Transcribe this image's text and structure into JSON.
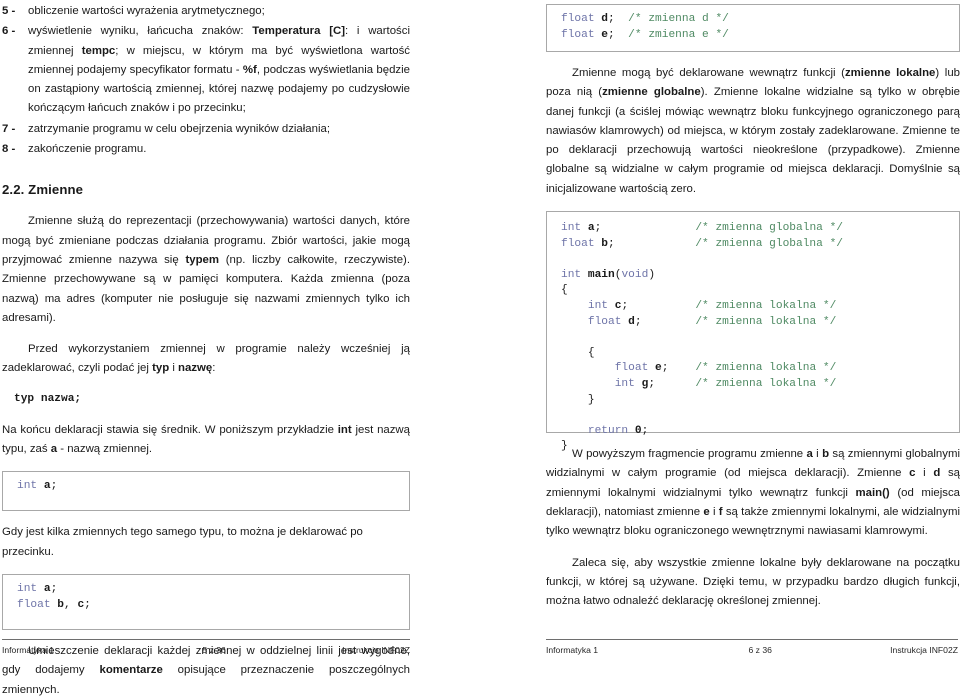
{
  "left_page": {
    "list": [
      {
        "num": "5 -",
        "parts": [
          {
            "t": "obliczenie wartości wyrażenia arytmetycznego;",
            "b": false
          }
        ]
      },
      {
        "num": "6 -",
        "parts": [
          {
            "t": "wyświetlenie wyniku, łańcucha znaków: ",
            "b": false
          },
          {
            "t": "Temperatura [C]",
            "b": true
          },
          {
            "t": ": i wartości zmiennej ",
            "b": false
          },
          {
            "t": "tempc",
            "b": true
          },
          {
            "t": "; w miejscu, w którym ma być wyświetlona wartość zmiennej podajemy specyfikator formatu - ",
            "b": false
          },
          {
            "t": "%f",
            "b": true
          },
          {
            "t": ", podczas wyświetlania będzie on zastąpiony wartością zmiennej, której nazwę podajemy po cudzysłowie kończącym łańcuch znaków i po przecinku;",
            "b": false
          }
        ]
      },
      {
        "num": "7 -",
        "parts": [
          {
            "t": "zatrzymanie programu w celu obejrzenia wyników działania;",
            "b": false
          }
        ]
      },
      {
        "num": "8 -",
        "parts": [
          {
            "t": "zakończenie programu.",
            "b": false
          }
        ]
      }
    ],
    "heading": "2.2. Zmienne",
    "paragraphs": [
      {
        "id": "p1",
        "parts": [
          {
            "t": "Zmienne służą do reprezentacji (przechowywania) wartości danych, które mogą być zmieniane podczas działania programu. Zbiór wartości, jakie mogą przyjmować zmienne nazywa się ",
            "b": false
          },
          {
            "t": "typem",
            "b": true
          },
          {
            "t": " (np. liczby całkowite, rzeczywiste). Zmienne przechowywane są w pamięci komputera. Każda zmienna (poza nazwą) ma adres (komputer nie posługuje się nazwami zmiennych tylko ich adresami).",
            "b": false
          }
        ]
      },
      {
        "id": "p2",
        "parts": [
          {
            "t": "Przed wykorzystaniem zmiennej w programie należy wcześniej ją zadeklarować, czyli podać jej ",
            "b": false
          },
          {
            "t": "typ",
            "b": true
          },
          {
            "t": " i ",
            "b": false
          },
          {
            "t": "nazwę",
            "b": true
          },
          {
            "t": ":",
            "b": false
          }
        ]
      },
      {
        "id": "p3",
        "parts": [
          {
            "t": "Na końcu deklaracji stawia się średnik. W poniższym przykładzie ",
            "b": false
          },
          {
            "t": "int",
            "b": true
          },
          {
            "t": " jest nazwą typu, zaś ",
            "b": false
          },
          {
            "t": "a",
            "b": true
          },
          {
            "t": " - nazwą zmiennej.",
            "b": false
          }
        ]
      },
      {
        "id": "p4",
        "parts": [
          {
            "t": "Gdy jest kilka zmiennych tego samego typu, to można je deklarować po przecinku.",
            "b": false
          }
        ]
      },
      {
        "id": "p5",
        "parts": [
          {
            "t": "Umieszczenie deklaracji każdej zmiennej w oddzielnej linii jest wygodne, gdy dodajemy ",
            "b": false
          },
          {
            "t": "komentarze",
            "b": true
          },
          {
            "t": " opisujące przeznaczenie poszczególnych zmiennych.",
            "b": false
          }
        ]
      }
    ],
    "code_inline": "typ nazwa;",
    "code_box_a": [
      [
        {
          "t": "int",
          "c": "kw"
        },
        {
          "t": " ",
          "c": "pn"
        },
        {
          "t": "a",
          "c": "id"
        },
        {
          "t": ";",
          "c": "pn"
        }
      ]
    ],
    "code_box_bc": [
      [
        {
          "t": "int",
          "c": "kw"
        },
        {
          "t": " ",
          "c": "pn"
        },
        {
          "t": "a",
          "c": "id"
        },
        {
          "t": ";",
          "c": "pn"
        }
      ],
      [
        {
          "t": "float",
          "c": "kw"
        },
        {
          "t": " ",
          "c": "pn"
        },
        {
          "t": "b",
          "c": "id"
        },
        {
          "t": ", ",
          "c": "pn"
        },
        {
          "t": "c",
          "c": "id"
        },
        {
          "t": ";",
          "c": "pn"
        }
      ]
    ],
    "footer": {
      "left": "Informatyka 1",
      "center": "5 z 36",
      "right": "Instrukcja INF02Z"
    }
  },
  "right_page": {
    "code_box_de": [
      [
        {
          "t": "float",
          "c": "kw"
        },
        {
          "t": " ",
          "c": "pn"
        },
        {
          "t": "d",
          "c": "id"
        },
        {
          "t": ";  ",
          "c": "pn"
        },
        {
          "t": "/* zmienna d */",
          "c": "cmt"
        }
      ],
      [
        {
          "t": "float",
          "c": "kw"
        },
        {
          "t": " ",
          "c": "pn"
        },
        {
          "t": "e",
          "c": "id"
        },
        {
          "t": ";  ",
          "c": "pn"
        },
        {
          "t": "/* zmienna e */",
          "c": "cmt"
        }
      ]
    ],
    "paragraphs": [
      {
        "id": "r1",
        "parts": [
          {
            "t": "Zmienne mogą być deklarowane wewnątrz funkcji (",
            "b": false
          },
          {
            "t": "zmienne lokalne",
            "b": true
          },
          {
            "t": ") lub poza nią (",
            "b": false
          },
          {
            "t": "zmienne globalne",
            "b": true
          },
          {
            "t": "). Zmienne lokalne widzialne są tylko w obrębie danej funkcji (a ściślej mówiąc wewnątrz bloku funkcyjnego ograniczonego parą nawiasów klamrowych) od miejsca, w którym zostały zadeklarowane. Zmienne te po deklaracji przechowują wartości nieokreślone (przypadkowe). Zmienne globalne są widzialne w całym programie od miejsca deklaracji. Domyślnie są inicjalizowane wartością zero.",
            "b": false
          }
        ]
      },
      {
        "id": "r2",
        "parts": [
          {
            "t": "W powyższym fragmencie programu zmienne ",
            "b": false
          },
          {
            "t": "a",
            "b": true
          },
          {
            "t": " i ",
            "b": false
          },
          {
            "t": "b",
            "b": true
          },
          {
            "t": " są zmiennymi globalnymi widzialnymi w całym programie (od miejsca deklaracji). Zmienne ",
            "b": false
          },
          {
            "t": "c",
            "b": true
          },
          {
            "t": " i ",
            "b": false
          },
          {
            "t": "d",
            "b": true
          },
          {
            "t": " są zmiennymi lokalnymi widzialnymi tylko wewnątrz funkcji ",
            "b": false
          },
          {
            "t": "main()",
            "b": true
          },
          {
            "t": " (od miejsca deklaracji), natomiast zmienne ",
            "b": false
          },
          {
            "t": "e",
            "b": true
          },
          {
            "t": " i ",
            "b": false
          },
          {
            "t": "f",
            "b": true
          },
          {
            "t": " są także zmiennymi lokalnymi, ale widzialnymi tylko wewnątrz bloku ograniczonego wewnętrznymi nawiasami klamrowymi.",
            "b": false
          }
        ]
      },
      {
        "id": "r3",
        "parts": [
          {
            "t": "Zaleca się, aby wszystkie zmienne lokalne były deklarowane na początku funkcji, w której są używane. Dzięki temu, w przypadku bardzo długich funkcji, można łatwo odnaleźć deklarację określonej zmiennej.",
            "b": false
          }
        ]
      }
    ],
    "code_box_main": [
      [
        {
          "t": "int",
          "c": "kw"
        },
        {
          "t": " ",
          "c": "pn"
        },
        {
          "t": "a",
          "c": "id"
        },
        {
          "t": ";              ",
          "c": "pn"
        },
        {
          "t": "/* zmienna globalna */",
          "c": "cmt"
        }
      ],
      [
        {
          "t": "float",
          "c": "kw"
        },
        {
          "t": " ",
          "c": "pn"
        },
        {
          "t": "b",
          "c": "id"
        },
        {
          "t": ";            ",
          "c": "pn"
        },
        {
          "t": "/* zmienna globalna */",
          "c": "cmt"
        }
      ],
      [
        {
          "t": "",
          "c": "pn"
        }
      ],
      [
        {
          "t": "int",
          "c": "kw"
        },
        {
          "t": " ",
          "c": "pn"
        },
        {
          "t": "main",
          "c": "id"
        },
        {
          "t": "(",
          "c": "pn"
        },
        {
          "t": "void",
          "c": "kw"
        },
        {
          "t": ")",
          "c": "pn"
        }
      ],
      [
        {
          "t": "{",
          "c": "pn"
        }
      ],
      [
        {
          "t": "    ",
          "c": "pn"
        },
        {
          "t": "int",
          "c": "kw"
        },
        {
          "t": " ",
          "c": "pn"
        },
        {
          "t": "c",
          "c": "id"
        },
        {
          "t": ";          ",
          "c": "pn"
        },
        {
          "t": "/* zmienna lokalna */",
          "c": "cmt"
        }
      ],
      [
        {
          "t": "    ",
          "c": "pn"
        },
        {
          "t": "float",
          "c": "kw"
        },
        {
          "t": " ",
          "c": "pn"
        },
        {
          "t": "d",
          "c": "id"
        },
        {
          "t": ";        ",
          "c": "pn"
        },
        {
          "t": "/* zmienna lokalna */",
          "c": "cmt"
        }
      ],
      [
        {
          "t": "",
          "c": "pn"
        }
      ],
      [
        {
          "t": "    {",
          "c": "pn"
        }
      ],
      [
        {
          "t": "        ",
          "c": "pn"
        },
        {
          "t": "float",
          "c": "kw"
        },
        {
          "t": " ",
          "c": "pn"
        },
        {
          "t": "e",
          "c": "id"
        },
        {
          "t": ";    ",
          "c": "pn"
        },
        {
          "t": "/* zmienna lokalna */",
          "c": "cmt"
        }
      ],
      [
        {
          "t": "        ",
          "c": "pn"
        },
        {
          "t": "int",
          "c": "kw"
        },
        {
          "t": " ",
          "c": "pn"
        },
        {
          "t": "g",
          "c": "id"
        },
        {
          "t": ";      ",
          "c": "pn"
        },
        {
          "t": "/* zmienna lokalna */",
          "c": "cmt"
        }
      ],
      [
        {
          "t": "    }",
          "c": "pn"
        }
      ],
      [
        {
          "t": "",
          "c": "pn"
        }
      ],
      [
        {
          "t": "    ",
          "c": "pn"
        },
        {
          "t": "return",
          "c": "kw"
        },
        {
          "t": " ",
          "c": "pn"
        },
        {
          "t": "0",
          "c": "num"
        },
        {
          "t": ";",
          "c": "pn"
        }
      ],
      [
        {
          "t": "}",
          "c": "pn"
        }
      ]
    ],
    "footer": {
      "left": "Informatyka 1",
      "center": "6 z 36",
      "right": "Instrukcja INF02Z"
    }
  },
  "colors": {
    "keyword": "#6e74a8",
    "comment": "#4f8a63",
    "text": "#1a1a1a",
    "box_border": "#a8a8a8",
    "rule": "#6e6e6e"
  }
}
